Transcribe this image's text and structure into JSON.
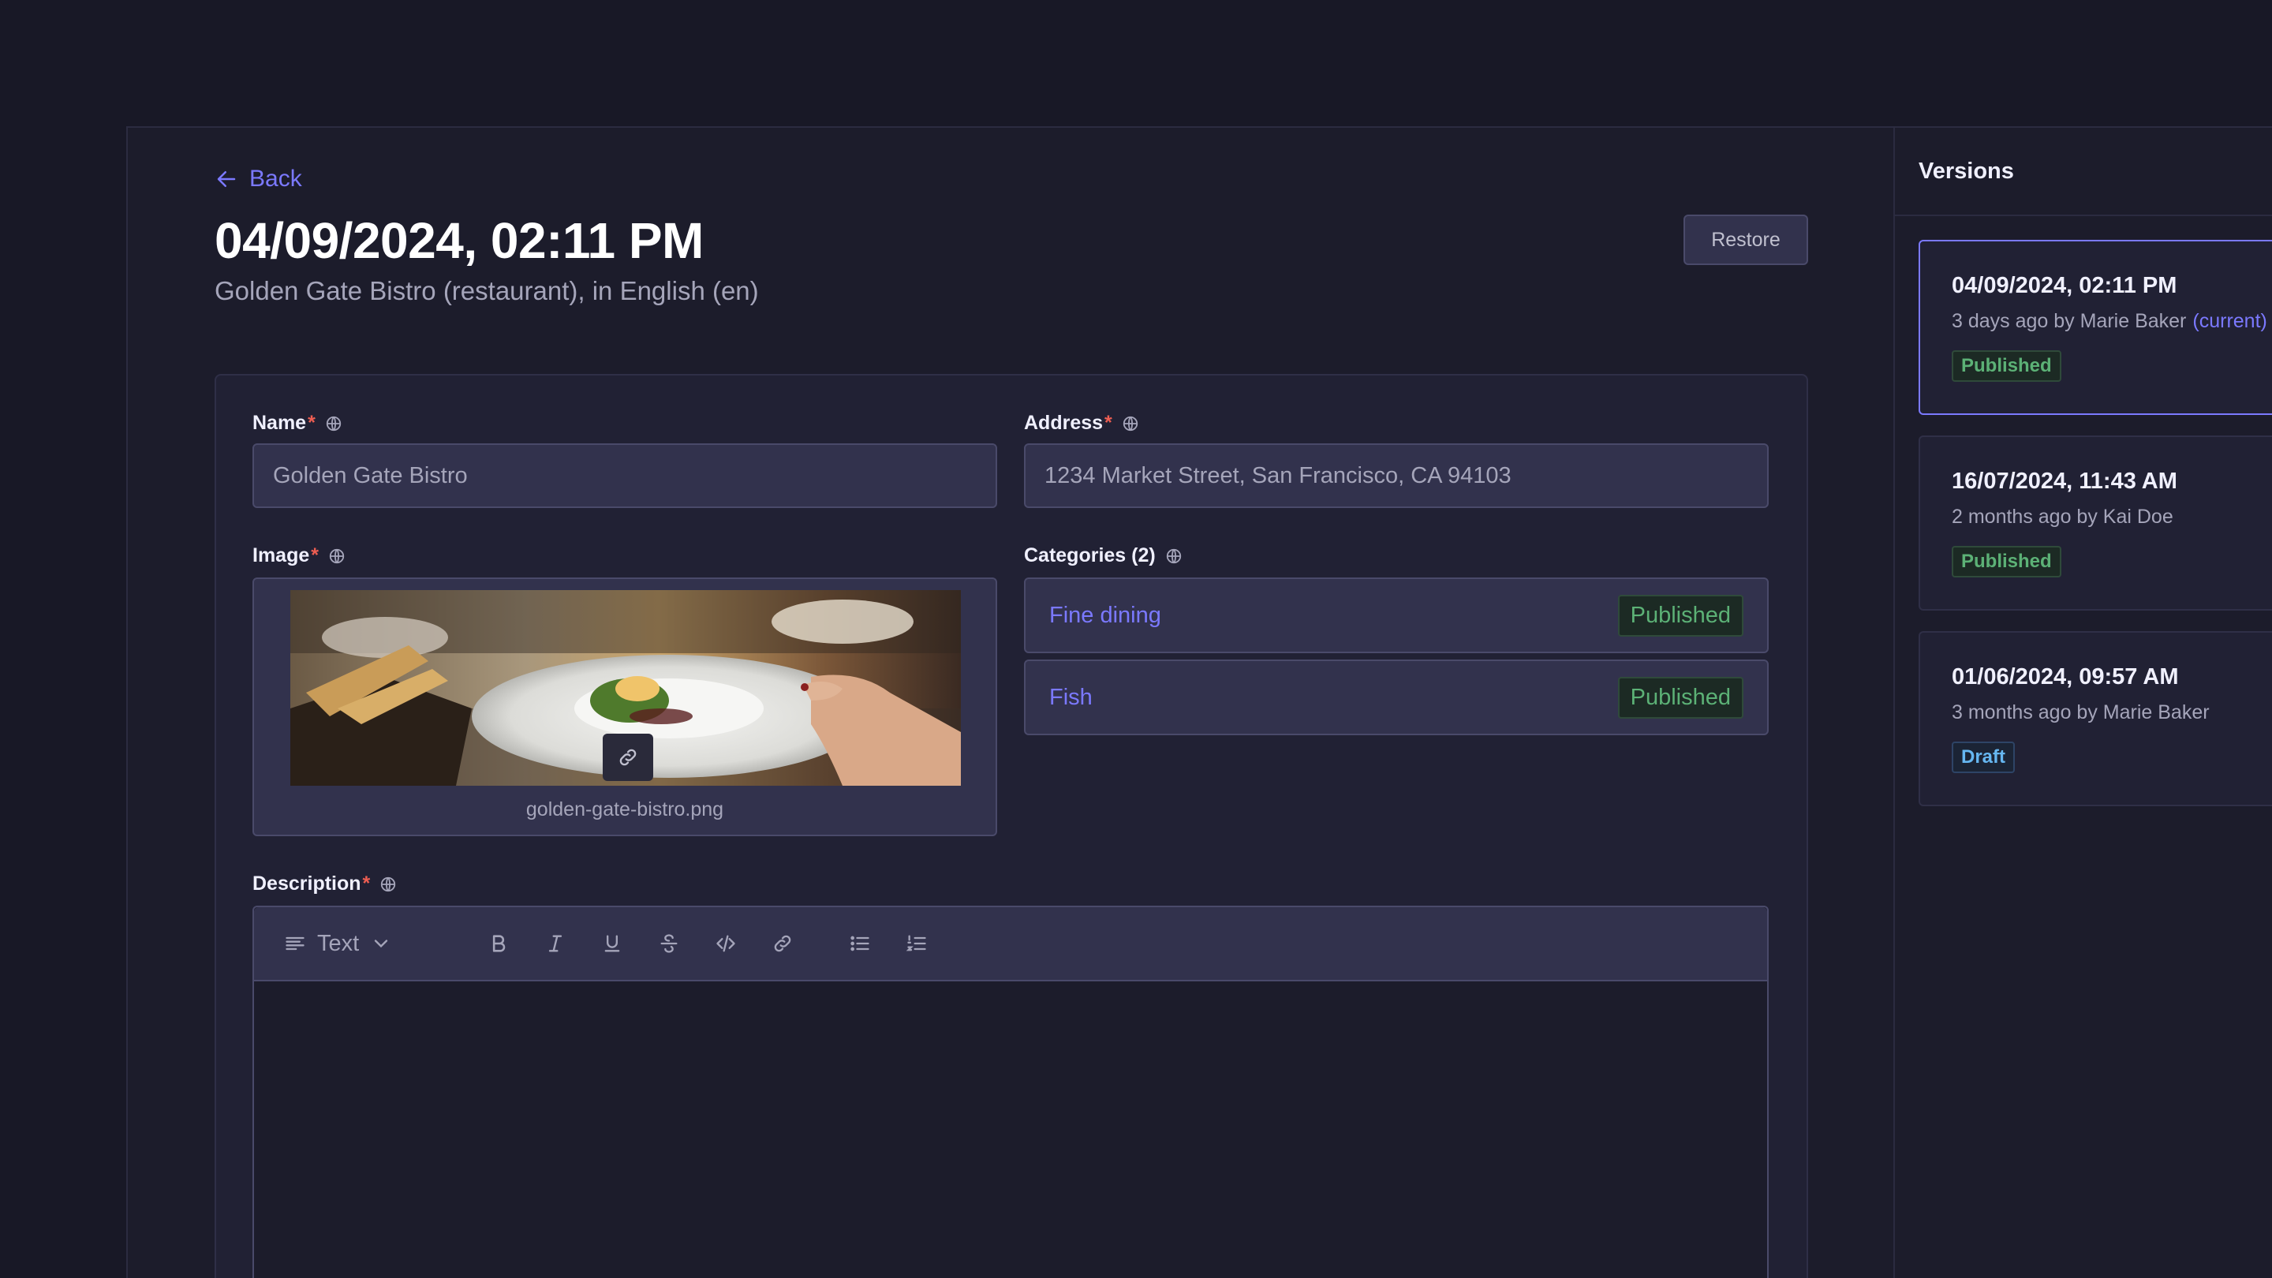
{
  "header": {
    "back_label": "Back",
    "title": "04/09/2024, 02:11 PM",
    "subtitle": "Golden Gate Bistro (restaurant), in English (en)",
    "restore_label": "Restore"
  },
  "form": {
    "name": {
      "label": "Name",
      "required": "*",
      "value": "Golden Gate Bistro"
    },
    "address": {
      "label": "Address",
      "required": "*",
      "value": "1234 Market Street, San Francisco, CA 94103"
    },
    "image": {
      "label": "Image",
      "required": "*",
      "filename": "golden-gate-bistro.png"
    },
    "categories": {
      "label": "Categories (2)",
      "items": [
        {
          "name": "Fine dining",
          "status": "Published"
        },
        {
          "name": "Fish",
          "status": "Published"
        }
      ]
    },
    "description": {
      "label": "Description",
      "required": "*",
      "block_type": "Text",
      "toolbar_icons": [
        "bold-icon",
        "italic-icon",
        "underline-icon",
        "strikethrough-icon",
        "code-icon",
        "link-icon",
        "bulleted-list-icon",
        "numbered-list-icon"
      ]
    }
  },
  "versions": {
    "title": "Versions",
    "items": [
      {
        "date": "04/09/2024, 02:11 PM",
        "meta": "3 days ago by Marie Baker",
        "current": "(current)",
        "status": "Published"
      },
      {
        "date": "16/07/2024, 11:43 AM",
        "meta": "2 months ago by Kai Doe",
        "status": "Published"
      },
      {
        "date": "01/06/2024, 09:57 AM",
        "meta": "3 months ago by Marie Baker",
        "status": "Draft"
      }
    ]
  },
  "colors": {
    "background": "#181826",
    "panel": "#212134",
    "accent": "#7b79ff",
    "published": "#5cb176",
    "draft": "#66b7f1",
    "required": "#ee5e52"
  }
}
